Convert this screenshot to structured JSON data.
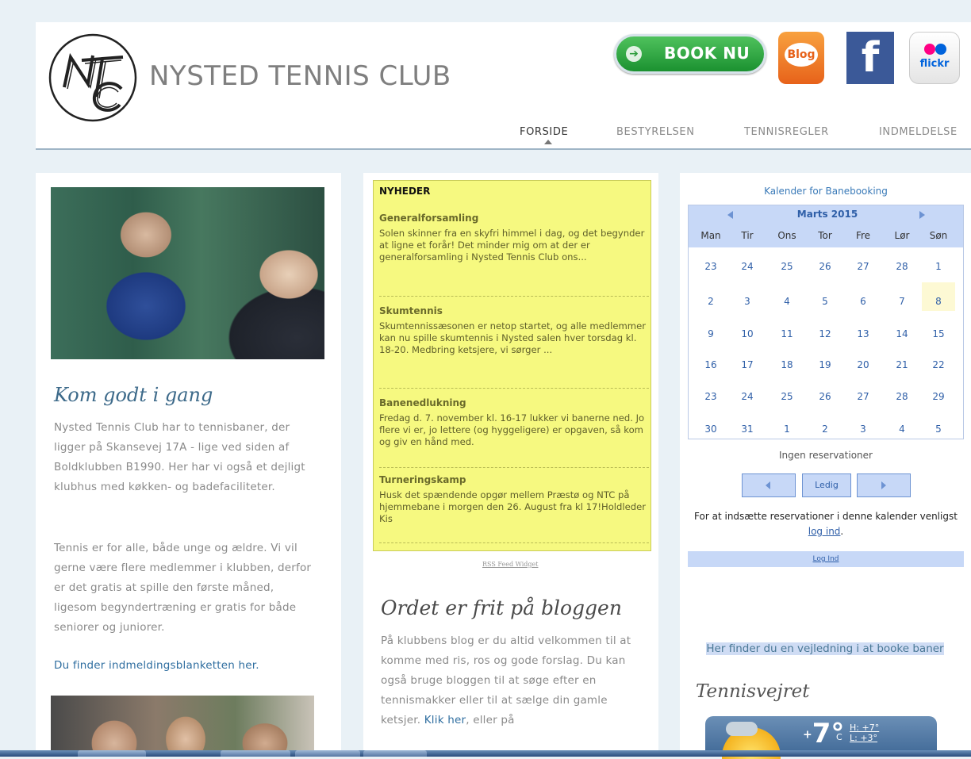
{
  "header": {
    "site_title": "NYSTED TENNIS CLUB",
    "logo_text": "NTC",
    "book_button": "BOOK NU",
    "blog_button": "Blog",
    "facebook_button": "f",
    "flickr_button": "flickr",
    "nav": [
      "FORSIDE",
      "BESTYRELSEN",
      "TENNISREGLER",
      "INDMELDELSE"
    ]
  },
  "left": {
    "title": "Kom godt i gang",
    "paragraph1": "Nysted Tennis Club har to tennisbaner, der ligger på Skansevej 17A - lige ved siden af Boldklubben B1990. Her har vi også et dejligt klubhus med køkken- og badefaciliteter.",
    "paragraph2": "Tennis er for alle, både unge og ældre. Vi vil gerne være flere medlemmer i klubben, derfor  er det gratis at spille den første måned, ligesom begyndertræning er gratis for både seniorer og juniorer.",
    "link": "Du finder indmeldingsblanketten her."
  },
  "news": {
    "heading": "NYHEDER",
    "items": [
      {
        "title": "Generalforsamling",
        "text": "Solen skinner fra en skyfri himmel i dag, og det begynder at ligne et forår! Det minder mig om at der er generalforsamling i Nysted Tennis Club ons..."
      },
      {
        "title": "Skumtennis",
        "text": "Skumtennissæsonen er netop startet, og alle medlemmer kan nu spille skumtennis i Nysted salen hver torsdag kl. 18-20. Medbring ketsjere, vi sørger ..."
      },
      {
        "title": "Banenedlukning",
        "text": "Fredag d. 7. november kl. 16-17 lukker vi banerne ned. Jo flere vi er, jo lettere (og hyggeligere) er opgaven, så kom og giv en hånd med."
      },
      {
        "title": "Turneringskamp",
        "text": "Husk det spændende opgør mellem Præstø og NTC på hjemmebane i morgen den 26. August fra kl 17!Holdleder Kis"
      }
    ],
    "rss": "RSS Feed Widget"
  },
  "blog": {
    "title": "Ordet er frit på bloggen",
    "text": "På klubbens blog er du altid velkommen til at komme med ris, ros og gode forslag. Du kan også bruge bloggen til at søge efter en tennismakker eller til at sælge din gamle ketsjer. ",
    "link": "Klik her",
    "text_after": ", eller på"
  },
  "calendar": {
    "title": "Kalender for Banebooking",
    "month": "Marts 2015",
    "weekdays": [
      "Man",
      "Tir",
      "Ons",
      "Tor",
      "Fre",
      "Lør",
      "Søn"
    ],
    "weeks": [
      [
        "23",
        "24",
        "25",
        "26",
        "27",
        "28",
        "1"
      ],
      [
        "2",
        "3",
        "4",
        "5",
        "6",
        "7",
        "8"
      ],
      [
        "9",
        "10",
        "11",
        "12",
        "13",
        "14",
        "15"
      ],
      [
        "16",
        "17",
        "18",
        "19",
        "20",
        "21",
        "22"
      ],
      [
        "23",
        "24",
        "25",
        "26",
        "27",
        "28",
        "29"
      ],
      [
        "30",
        "31",
        "1",
        "2",
        "3",
        "4",
        "5"
      ]
    ],
    "no_reservations": "Ingen reservationer",
    "ledig": "Ledig",
    "note_before": "For at indsætte reservationer i denne kalender venligst ",
    "note_link": "log ind",
    "note_after": ".",
    "login": "Log Ind"
  },
  "sidebar": {
    "guide": "Her finder du en vejledning i at booke baner",
    "weather_title": "Tennisvejret",
    "temperature": "7°",
    "temp_prefix": "+",
    "unit": "C",
    "high": "H: +7°",
    "low": "L: +3°"
  },
  "colors": {
    "accent_blue": "#2f6ea0",
    "news_yellow": "#f6f980",
    "book_green": "#1b9130",
    "facebook": "#3b5998"
  }
}
